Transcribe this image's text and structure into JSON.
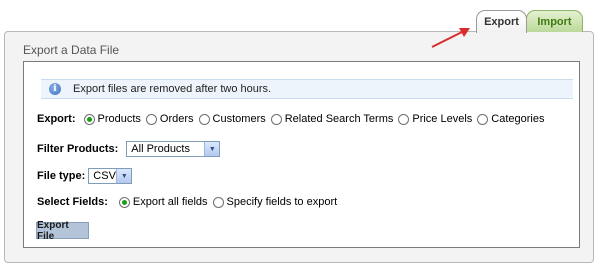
{
  "tabs": {
    "export_label": "Export",
    "import_label": "Import"
  },
  "panel": {
    "title": "Export a Data File"
  },
  "info": {
    "icon": "info-icon",
    "message": "Export files are removed after two hours."
  },
  "export_type": {
    "label": "Export:",
    "options": [
      "Products",
      "Orders",
      "Customers",
      "Related Search Terms",
      "Price Levels",
      "Categories"
    ],
    "selected": "Products"
  },
  "filter_products": {
    "label": "Filter Products:",
    "value": "All Products"
  },
  "file_type": {
    "label": "File type:",
    "value": "CSV"
  },
  "select_fields": {
    "label": "Select Fields:",
    "options": [
      "Export all fields",
      "Specify fields to export"
    ],
    "selected": "Export all fields"
  },
  "actions": {
    "export_file_label": "Export File"
  },
  "colors": {
    "annotation_arrow": "#d92c2c",
    "radio_selected": "#1a9e1a",
    "import_tab_text": "#3f7a12",
    "export_button_bg": "#b3c4d8"
  }
}
